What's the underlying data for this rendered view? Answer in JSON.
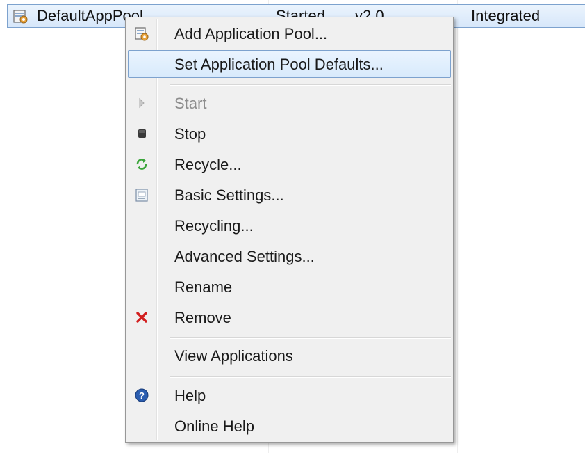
{
  "list": {
    "row": {
      "name": "DefaultAppPool",
      "status": "Started",
      "runtime": "v2.0",
      "mode": "Integrated"
    }
  },
  "menu": {
    "items": [
      {
        "label": "Add Application Pool...",
        "icon": "add-app-pool-icon"
      },
      {
        "label": "Set Application Pool Defaults...",
        "icon": "",
        "highlighted": true
      },
      {
        "label": "Start",
        "icon": "start-icon",
        "disabled": true
      },
      {
        "label": "Stop",
        "icon": "stop-icon"
      },
      {
        "label": "Recycle...",
        "icon": "recycle-icon"
      },
      {
        "label": "Basic Settings...",
        "icon": "basic-settings-icon"
      },
      {
        "label": "Recycling...",
        "icon": ""
      },
      {
        "label": "Advanced Settings...",
        "icon": ""
      },
      {
        "label": "Rename",
        "icon": ""
      },
      {
        "label": "Remove",
        "icon": "remove-icon"
      },
      {
        "label": "View Applications",
        "icon": ""
      },
      {
        "label": "Help",
        "icon": "help-icon"
      },
      {
        "label": "Online Help",
        "icon": ""
      }
    ]
  },
  "colors": {
    "highlight_border": "#7da2ce",
    "menu_background": "#f0f0f0",
    "remove_red": "#d21f1f",
    "recycle_green": "#3aa53a",
    "help_blue": "#2a5db0"
  }
}
